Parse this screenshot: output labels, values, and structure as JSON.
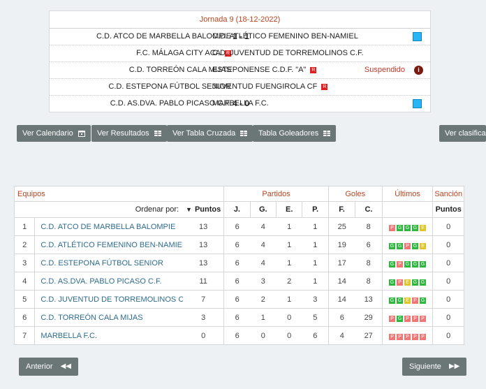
{
  "round_title": "Jornada 9 (18-12-2022)",
  "matches": [
    {
      "home": "C.D. ATCO DE MARBELLA BALOMPIE",
      "home_flag": false,
      "score": "1 - 1",
      "away": "C.D. ATLÉTICO FEMENINO BEN-NAMIEL",
      "away_flag": false,
      "status": "",
      "icon": "blue-square"
    },
    {
      "home": "F.C. MÁLAGA CITY ACA",
      "home_flag": true,
      "score": "",
      "away": "C.D. JUVENTUD DE TORREMOLINOS C.F.",
      "away_flag": false,
      "status": "",
      "icon": ""
    },
    {
      "home": "C.D. TORREÓN CALA MIJAS",
      "home_flag": false,
      "score": "",
      "away": "ESTEPONENSE C.D.F. \"A\"",
      "away_flag": true,
      "status": "Suspendido",
      "icon": "info"
    },
    {
      "home": "C.D. ESTEPONA FÚTBOL SENIOR",
      "home_flag": false,
      "score": "",
      "away": "JUVENTUD FUENGIROLA CF",
      "away_flag": true,
      "status": "",
      "icon": ""
    },
    {
      "home": "C.D. AS.DVA. PABLO PICASO C.F.",
      "home_flag": false,
      "score": "4 - 0",
      "away": "MARBELLA F.C.",
      "away_flag": false,
      "status": "",
      "icon": "blue-square"
    }
  ],
  "flag_letter": "R",
  "buttons": {
    "calendario": "Ver Calendario",
    "resultados": "Ver Resultados",
    "tabla_cruzada": "Ver Tabla Cruzada",
    "goleadores": "Tabla Goleadores",
    "clasificacion": "Ver clasificac",
    "anterior": "Anterior",
    "siguiente": "Siguiente"
  },
  "table": {
    "group_headers": {
      "equipos": "Equipos",
      "partidos": "Partidos",
      "goles": "Goles",
      "ultimos": "Últimos",
      "sancion": "Sanción"
    },
    "order_label": "Ordenar por:",
    "columns": {
      "puntos": "Puntos",
      "j": "J.",
      "g": "G.",
      "e": "E.",
      "p": "P.",
      "f": "F.",
      "c": "C.",
      "puntos_sancion": "Puntos"
    },
    "rows": [
      {
        "pos": "1",
        "team": "C.D. ATCO DE MARBELLA BALOMPIE",
        "pts": "13",
        "j": "6",
        "g": "4",
        "e": "1",
        "p": "1",
        "f": "25",
        "c": "8",
        "last": [
          "P",
          "G",
          "G",
          "G",
          "E"
        ],
        "sancion": "0"
      },
      {
        "pos": "2",
        "team": "C.D. ATLÉTICO FEMENINO BEN-NAMIEL",
        "pts": "13",
        "j": "6",
        "g": "4",
        "e": "1",
        "p": "1",
        "f": "19",
        "c": "6",
        "last": [
          "G",
          "G",
          "P",
          "G",
          "E"
        ],
        "sancion": "0"
      },
      {
        "pos": "3",
        "team": "C.D. ESTEPONA FÚTBOL SENIOR",
        "pts": "13",
        "j": "6",
        "g": "4",
        "e": "1",
        "p": "1",
        "f": "17",
        "c": "8",
        "last": [
          "G",
          "P",
          "G",
          "G",
          "G"
        ],
        "sancion": "0"
      },
      {
        "pos": "4",
        "team": "C.D. AS.DVA. PABLO PICASO C.F.",
        "pts": "11",
        "j": "6",
        "g": "3",
        "e": "2",
        "p": "1",
        "f": "14",
        "c": "8",
        "last": [
          "G",
          "P",
          "E",
          "G",
          "G"
        ],
        "sancion": "0"
      },
      {
        "pos": "5",
        "team": "C.D. JUVENTUD DE TORREMOLINOS C.F.",
        "pts": "7",
        "j": "6",
        "g": "2",
        "e": "1",
        "p": "3",
        "f": "14",
        "c": "13",
        "last": [
          "G",
          "G",
          "E",
          "P",
          "G"
        ],
        "sancion": "0"
      },
      {
        "pos": "6",
        "team": "C.D. TORREÓN CALA MIJAS",
        "pts": "3",
        "j": "6",
        "g": "1",
        "e": "0",
        "p": "5",
        "f": "6",
        "c": "29",
        "last": [
          "P",
          "G",
          "P",
          "P",
          "P"
        ],
        "sancion": "0"
      },
      {
        "pos": "7",
        "team": "MARBELLA F.C.",
        "pts": "0",
        "j": "6",
        "g": "0",
        "e": "0",
        "p": "6",
        "f": "4",
        "c": "27",
        "last": [
          "P",
          "P",
          "P",
          "P",
          "P"
        ],
        "sancion": "0"
      }
    ]
  },
  "colors": {
    "accent": "#b5441f",
    "link": "#2e6c8f",
    "button": "#6b7676",
    "win": "#2db83d",
    "loss": "#f07575",
    "draw": "#e0c52a"
  }
}
